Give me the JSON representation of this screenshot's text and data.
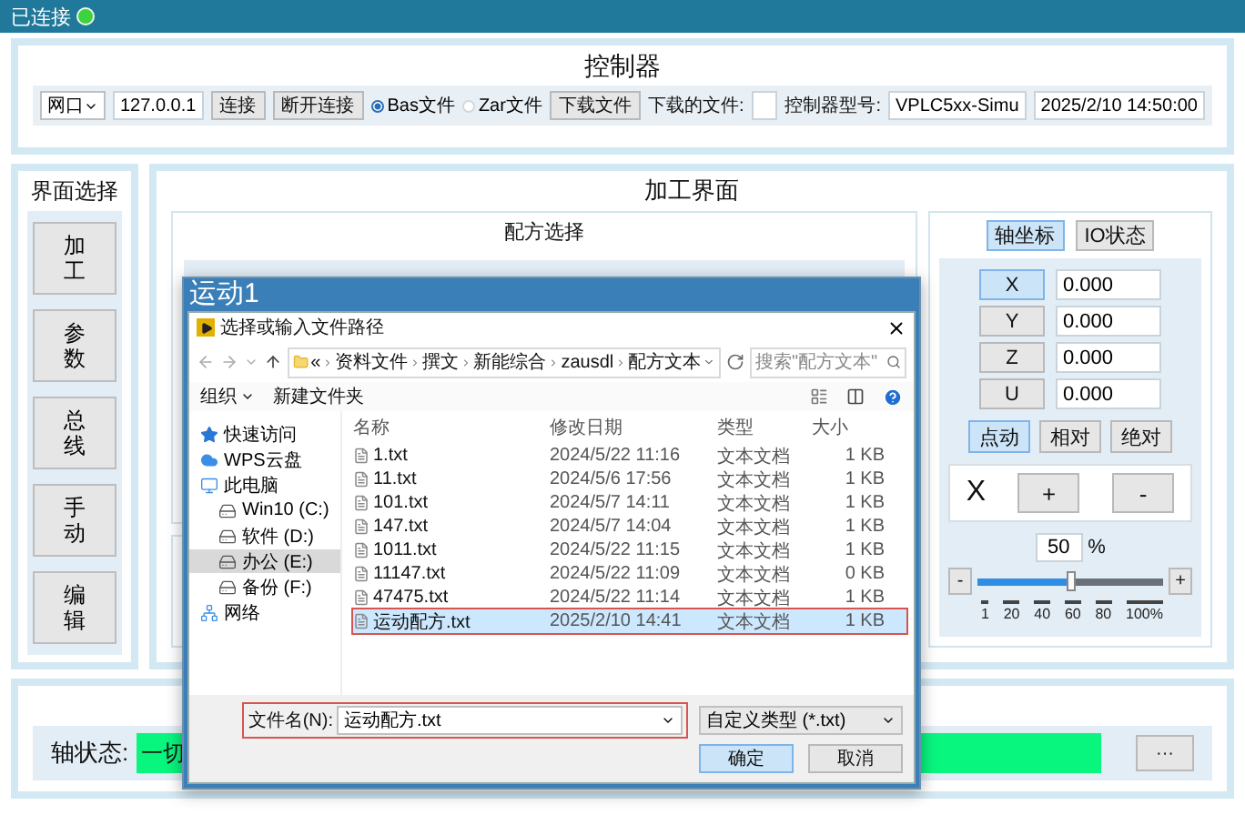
{
  "top_bar": {
    "text": "已连接",
    "connected": true
  },
  "controller": {
    "title": "控制器",
    "port": "网口",
    "ip": "127.0.0.1",
    "connect_button": "连接",
    "disconnect_button": "断开连接",
    "file_types": [
      {
        "label": "Bas文件",
        "selected": true
      },
      {
        "label": "Zar文件",
        "selected": false
      }
    ],
    "download_button": "下载文件",
    "downloaded_label": "下载的文件:",
    "model_label": "控制器型号:",
    "model_value": "VPLC5xx-Simu",
    "datetime": "2025/2/10 14:50:00"
  },
  "sidebar": {
    "title": "界面选择",
    "items": [
      {
        "label": "加工"
      },
      {
        "label": "参数"
      },
      {
        "label": "总线"
      },
      {
        "label": "手动"
      },
      {
        "label": "编辑"
      }
    ]
  },
  "main": {
    "title": "加工界面",
    "recipe_panel": {
      "title": "配方选择"
    },
    "axis_panel": {
      "tabs": [
        {
          "label": "轴坐标",
          "selected": true
        },
        {
          "label": "IO状态",
          "selected": false
        }
      ],
      "axes": [
        {
          "label": "X",
          "value": "0.000",
          "selected": true
        },
        {
          "label": "Y",
          "value": "0.000",
          "selected": false
        },
        {
          "label": "Z",
          "value": "0.000",
          "selected": false
        },
        {
          "label": "U",
          "value": "0.000",
          "selected": false
        }
      ],
      "modes": [
        {
          "label": "点动",
          "selected": true
        },
        {
          "label": "相对",
          "selected": false
        },
        {
          "label": "绝对",
          "selected": false
        }
      ],
      "jog": {
        "axis": "X",
        "plus": "+",
        "minus": "-"
      },
      "speed": {
        "value": "50",
        "unit": "%",
        "minus": "-",
        "plus": "+",
        "level": 0.5,
        "ticks": [
          "1",
          "20",
          "40",
          "60",
          "80",
          "100%"
        ]
      }
    }
  },
  "axis_status": {
    "label": "轴状态:",
    "value": "一切",
    "more": "···"
  },
  "window": {
    "title": "运动1",
    "file_dialog": {
      "title": "选择或输入文件路径",
      "path_overflow": "«",
      "path": [
        "资料文件",
        "撰文",
        "新能综合",
        "zausdl",
        "配方文本"
      ],
      "search_placeholder": "搜索\"配方文本\"",
      "toolbar": [
        "组织",
        "新建文件夹"
      ],
      "nav": [
        {
          "label": "快速访问",
          "kind": "quick",
          "selected": false
        },
        {
          "label": "WPS云盘",
          "kind": "cloud",
          "selected": false
        },
        {
          "label": "此电脑",
          "kind": "pc",
          "selected": false,
          "children": [
            {
              "label": "Win10 (C:)",
              "kind": "drive",
              "selected": false
            },
            {
              "label": "软件 (D:)",
              "kind": "drive",
              "selected": false
            },
            {
              "label": "办公 (E:)",
              "kind": "drive",
              "selected": true
            },
            {
              "label": "备份 (F:)",
              "kind": "drive",
              "selected": false
            }
          ]
        },
        {
          "label": "网络",
          "kind": "network",
          "selected": false
        }
      ],
      "columns": [
        "名称",
        "修改日期",
        "类型",
        "大小"
      ],
      "files": [
        {
          "name": "1.txt",
          "date": "2024/5/22 11:16",
          "type": "文本文档",
          "size": "1 KB",
          "selected": false
        },
        {
          "name": "11.txt",
          "date": "2024/5/6 17:56",
          "type": "文本文档",
          "size": "1 KB",
          "selected": false
        },
        {
          "name": "101.txt",
          "date": "2024/5/7 14:11",
          "type": "文本文档",
          "size": "1 KB",
          "selected": false
        },
        {
          "name": "147.txt",
          "date": "2024/5/7 14:04",
          "type": "文本文档",
          "size": "1 KB",
          "selected": false
        },
        {
          "name": "1011.txt",
          "date": "2024/5/22 11:15",
          "type": "文本文档",
          "size": "1 KB",
          "selected": false
        },
        {
          "name": "11147.txt",
          "date": "2024/5/22 11:09",
          "type": "文本文档",
          "size": "0 KB",
          "selected": false
        },
        {
          "name": "47475.txt",
          "date": "2024/5/22 11:14",
          "type": "文本文档",
          "size": "1 KB",
          "selected": false
        },
        {
          "name": "运动配方.txt",
          "date": "2025/2/10 14:41",
          "type": "文本文档",
          "size": "1 KB",
          "selected": true
        }
      ],
      "filename_label": "文件名(N):",
      "filename": "运动配方.txt",
      "filename_highlighted": true,
      "filter": "自定义类型 (*.txt)",
      "ok_button": "确定",
      "cancel_button": "取消"
    }
  }
}
